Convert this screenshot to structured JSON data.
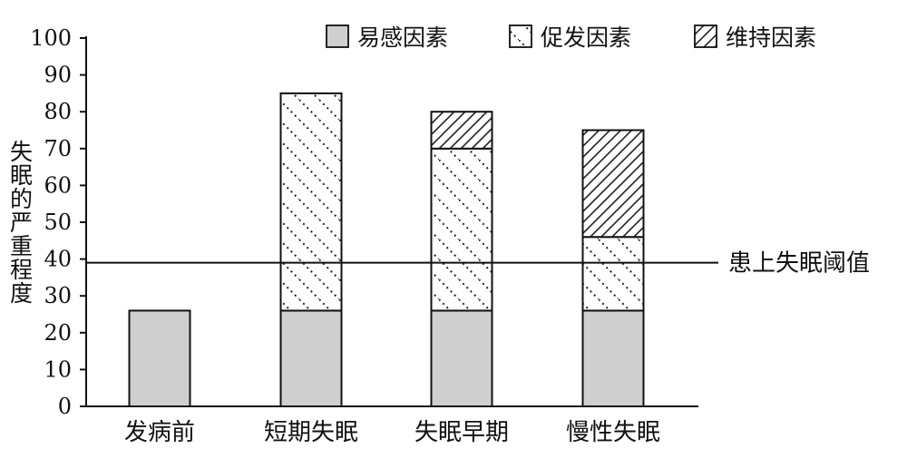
{
  "chart_data": {
    "type": "bar",
    "stacked": true,
    "categories": [
      "发病前",
      "短期失眠",
      "失眠早期",
      "慢性失眠"
    ],
    "series": [
      {
        "name": "易感因素",
        "values": [
          26,
          26,
          26,
          26
        ],
        "pattern": "solid",
        "color": "#cfcfcf"
      },
      {
        "name": "促发因素",
        "values": [
          0,
          59,
          44,
          20
        ],
        "pattern": "dotted-hatch",
        "color": "#ffffff"
      },
      {
        "name": "维持因素",
        "values": [
          0,
          0,
          10,
          29
        ],
        "pattern": "diagonal-hatch",
        "color": "#ffffff"
      }
    ],
    "ylabel": "失眠的严重程度",
    "ylim": [
      0,
      100
    ],
    "yticks": [
      0,
      10,
      20,
      30,
      40,
      50,
      60,
      70,
      80,
      90,
      100
    ],
    "threshold": {
      "value": 39,
      "label": "患上失眠阈值"
    },
    "legend_position": "top-right",
    "grid": false
  }
}
